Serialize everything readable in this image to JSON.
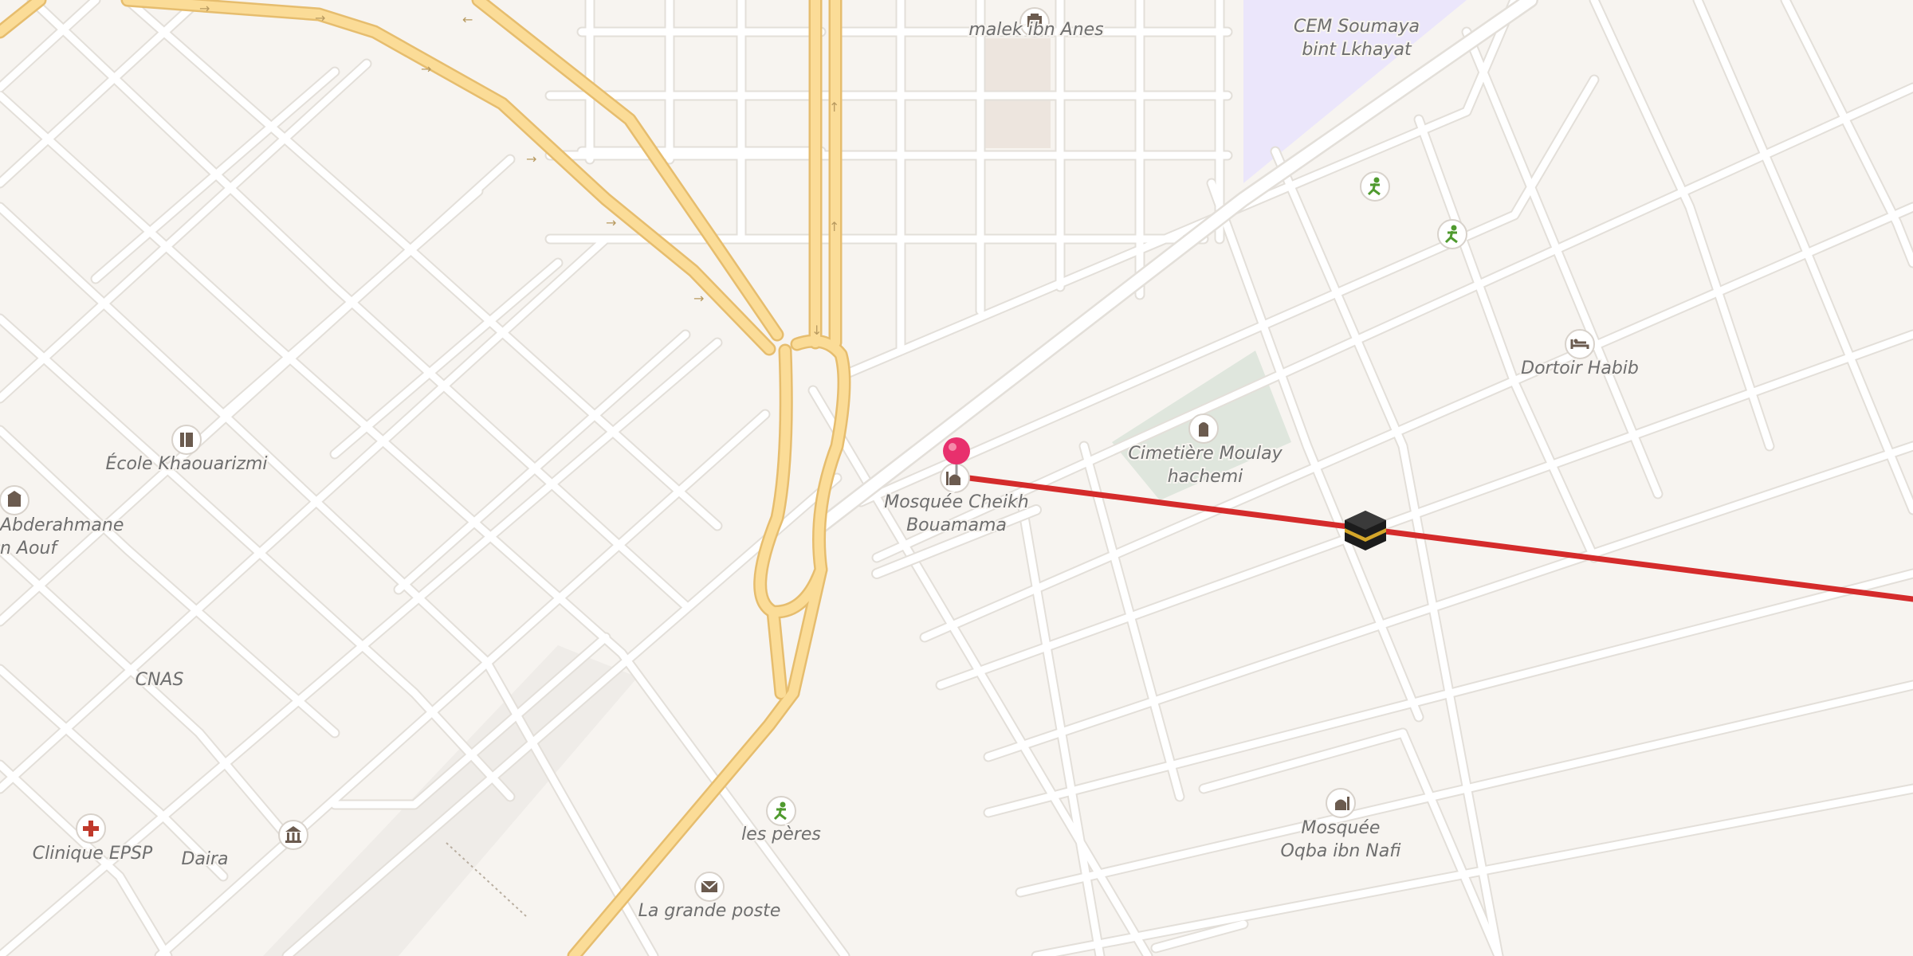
{
  "map": {
    "labels": {
      "malek": "malek ibn Anes",
      "cem_1": "CEM Soumaya",
      "cem_2": "bint Lkhayat",
      "mosque_cheikh_1": "Mosquée Cheikh",
      "mosque_cheikh_2": "Bouamama",
      "cemetery_1": "Cimetière Moulay",
      "cemetery_2": "hachemi",
      "dortoir": "Dortoir Habib",
      "ecole": "École Khaouarizmi",
      "abderahmane_1": "Abderahmane",
      "abderahmane_2": "n Aouf",
      "cnas": "CNAS",
      "clinique": "Clinique EPSP",
      "daira": "Daira",
      "peres": "les pères",
      "poste": "La grande poste",
      "mosque_oqba_1": "Mosquée",
      "mosque_oqba_2": "Oqba ibn Nafi"
    },
    "icons": {
      "school": "school-icon",
      "sports": "sports-icon",
      "hotel": "hotel-icon",
      "mosque": "mosque-icon",
      "cemetery": "cemetery-icon",
      "hospital": "hospital-icon",
      "government": "government-icon",
      "post": "post-office-icon",
      "kaaba": "kaaba-icon",
      "pin": "location-pin-icon"
    },
    "colors": {
      "background": "#f7f4f0",
      "road": "#ffffff",
      "road_casing": "#e3dfd9",
      "primary_road": "#fbdc97",
      "primary_casing": "#e6bd6e",
      "school_area": "#ebe6fb",
      "cemetery_area": "#dfe6dd",
      "qibla_line": "#d42b2b",
      "pin": "#e8306d",
      "sports_icon": "#4f9a2e",
      "hospital_icon": "#c0392b"
    }
  }
}
